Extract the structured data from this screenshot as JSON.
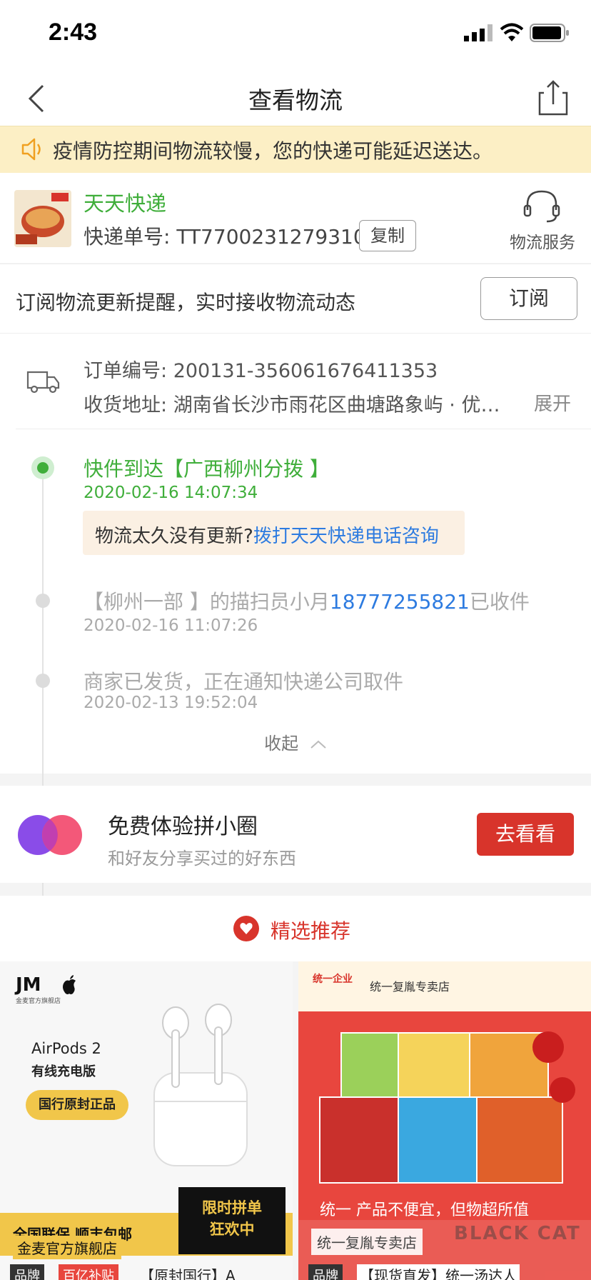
{
  "status_bar": {
    "time": "2:43"
  },
  "nav": {
    "title": "查看物流"
  },
  "notice": {
    "text": "疫情防控期间物流较慢，您的快递可能延迟送达。"
  },
  "courier": {
    "name": "天天快递",
    "tracking_label": "快递单号:",
    "tracking_number": "TT7700231279310",
    "copy_label": "复制",
    "service_label": "物流服务"
  },
  "subscribe": {
    "text": "订阅物流更新提醒，实时接收物流动态",
    "button": "订阅"
  },
  "order": {
    "number_label": "订单编号:",
    "number": "200131-356061676411353",
    "address_label": "收货地址:",
    "address": "湖南省长沙市雨花区曲塘路象屿 · 优…",
    "expand": "展开"
  },
  "timeline": [
    {
      "title": "快件到达【广西柳州分拨 】",
      "time": "2020-02-16 14:07:34"
    },
    {
      "title_prefix": "【柳州一部 】的描扫员小月",
      "phone": "18777255821",
      "title_suffix": "已收件",
      "time": "2020-02-16 11:07:26"
    },
    {
      "title": "商家已发货，正在通知快递公司取件",
      "time": "2020-02-13 19:52:04"
    }
  ],
  "hint": {
    "text": "物流太久没有更新?",
    "link": "拨打天天快递电话咨询"
  },
  "collapse_label": "收起",
  "pinxiaoquan": {
    "title": "免费体验拼小圈",
    "subtitle": "和好友分享买过的好东西",
    "button": "去看看"
  },
  "recommend": {
    "title": "精选推荐"
  },
  "products": [
    {
      "logo": "JM",
      "logo_sub": "金麦官方旗舰店",
      "name": "AirPods 2",
      "variant": "有线充电版",
      "pill": "国行原封正品",
      "bar_left": "全国联保  顺丰包邮",
      "bar_right_1": "限时拼单",
      "bar_right_2": "狂欢中",
      "store": "金麦官方旗舰店",
      "tag1": "品牌",
      "tag2": "百亿补贴",
      "title": "【原封国行】A"
    },
    {
      "logo": "统一企业",
      "store_header": "统一复胤专卖店",
      "foot": "统一 产品不便宜，但物超所值",
      "store": "统一复胤专卖店",
      "tag1": "品牌",
      "title": "【现货直发】统一汤达人"
    }
  ],
  "watermark": "BLACK CAT",
  "colors": {
    "green": "#3fae3a",
    "red": "#d8342b",
    "link": "#2d7be0",
    "notice_bg": "#fcefc5"
  }
}
